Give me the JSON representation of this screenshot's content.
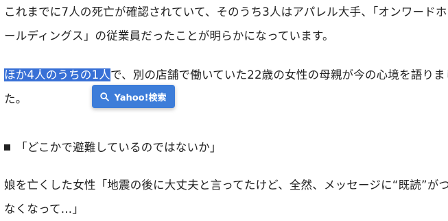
{
  "article": {
    "p1": {
      "line1": "これまでに7人の死亡が確認されていて、そのうち3人はアパレル大手、「オンワードホ",
      "line2": "ールディングス」の従業員だったことが明らかになっています。"
    },
    "p2": {
      "selected": "ほか4人のうちの1人",
      "line1_rest": "で、別の店舗で働いていた22歳の女性の母親が今の心境を語りまし",
      "line2": "た。"
    },
    "p3": {
      "bullet": "■",
      "text": "「どこかで避難しているのではないか」"
    },
    "p4": {
      "line1": "娘を亡くした女性「地震の後に大丈夫と言ってたけど、全然、メッセージに“既読”がつか",
      "line2": "なくなって…」"
    }
  },
  "search_popup": {
    "icon": "search-icon",
    "label": "Yahoo!検索"
  },
  "colors": {
    "selection": "#3870d6",
    "popup": "#3d7dd9",
    "text": "#222222"
  }
}
